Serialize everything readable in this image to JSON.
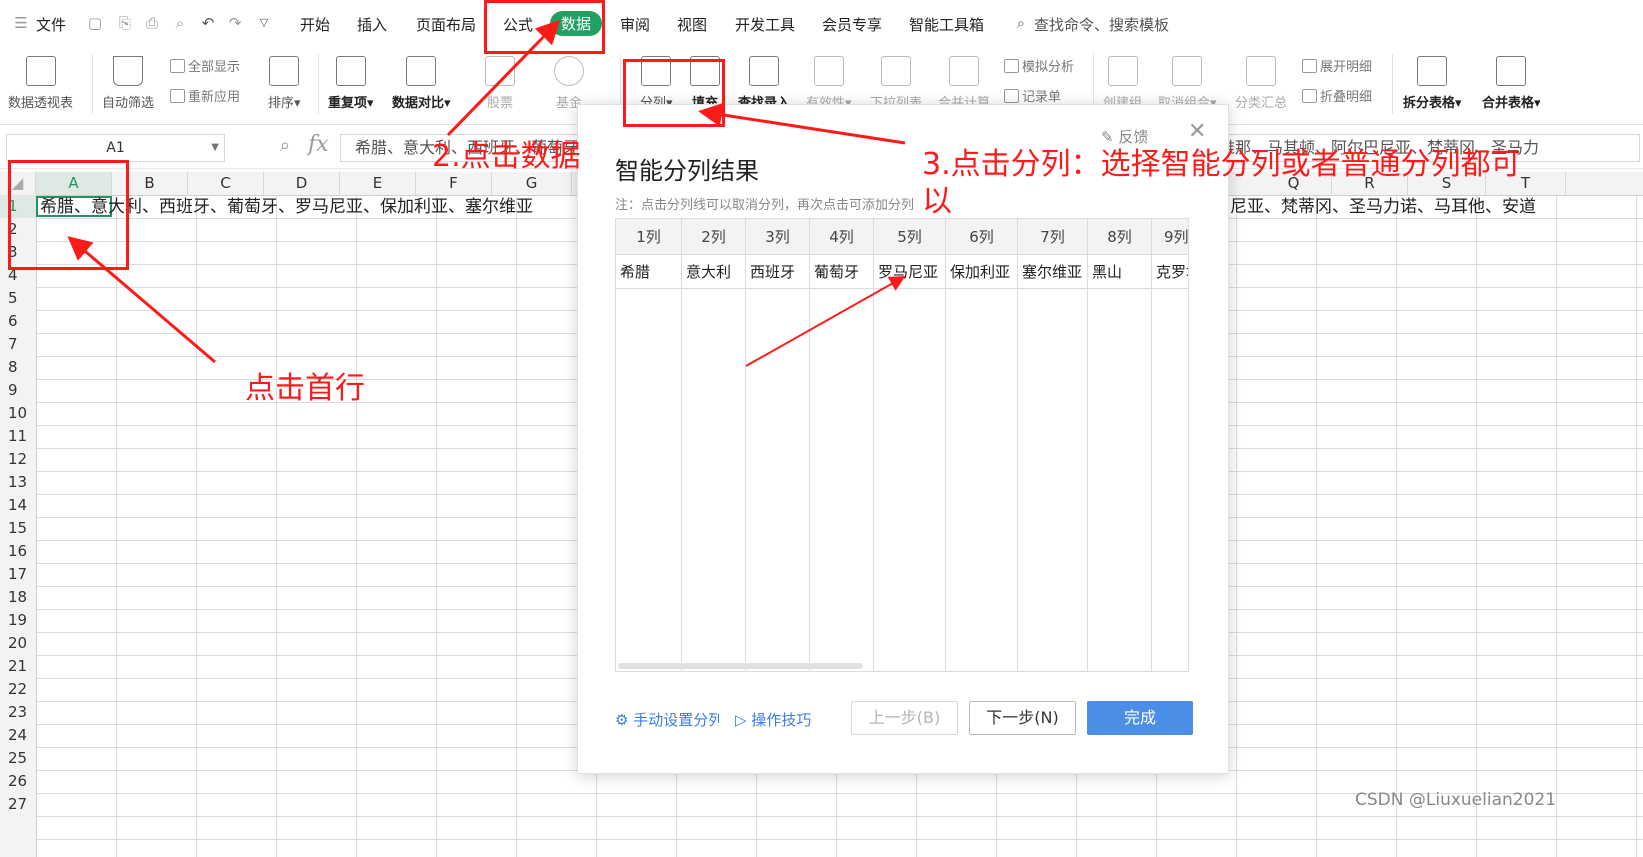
{
  "titlebar": {
    "file_menu": "文件",
    "tabs": [
      "开始",
      "插入",
      "页面布局",
      "公式",
      "数据",
      "审阅",
      "视图",
      "开发工具",
      "会员专享",
      "智能工具箱"
    ],
    "search": "查找命令、搜索模板"
  },
  "ribbon": {
    "items": [
      "数据透视表",
      "自动筛选",
      "全部显示",
      "重新应用",
      "排序",
      "重复项",
      "数据对比",
      "股票",
      "基金",
      "分列",
      "填充",
      "查找录入",
      "有效性",
      "下拉列表",
      "合并计算",
      "模拟分析",
      "记录单",
      "创建组",
      "取消组合",
      "分类汇总",
      "展开明细",
      "折叠明细",
      "拆分表格",
      "合并表格"
    ]
  },
  "formula_bar": {
    "name_box": "A1",
    "fx": "fx",
    "content": "希腊、意大利、西班牙、葡萄牙"
  },
  "sheet": {
    "columns": [
      "A",
      "B",
      "C",
      "D",
      "E",
      "F",
      "G",
      "Q",
      "R",
      "S",
      "T"
    ],
    "rows": [
      "1",
      "2",
      "3",
      "4",
      "5",
      "6",
      "7",
      "8",
      "9",
      "10",
      "11",
      "12",
      "13",
      "14",
      "15",
      "16",
      "17",
      "18",
      "19",
      "20",
      "21",
      "22",
      "23",
      "24",
      "25",
      "26",
      "27"
    ],
    "a1_text": "希腊、意大利、西班牙、葡萄牙、罗马尼亚、保加利亚、塞尔维亚",
    "row1_tail": "尼亚、梵蒂冈、圣马力诺、马耳他、安道",
    "formula_tail": "维那、马其顿、阿尔巴尼亚、梵蒂冈、圣马力"
  },
  "dialog": {
    "title": "智能分列结果",
    "note": "注：点击分列线可以取消分列，再次点击可添加分列",
    "feedback": "反馈",
    "close": "✕",
    "columns": [
      "1列",
      "2列",
      "3列",
      "4列",
      "5列",
      "6列",
      "7列",
      "8列",
      "9列"
    ],
    "values": [
      "希腊",
      "意大利",
      "西班牙",
      "葡萄牙",
      "罗马尼亚",
      "保加利亚",
      "塞尔维亚",
      "黑山",
      "克罗地"
    ],
    "manual_link": "手动设置分列",
    "tips_link": "操作技巧",
    "prev_button": "上一步(B)",
    "next_button": "下一步(N)",
    "done_button": "完成"
  },
  "annotations": {
    "step1": "点击首行",
    "step2": "2.点击数据",
    "step3_line1": "3.点击分列：选择智能分列或者普通分列都可",
    "step3_line2": "以"
  },
  "watermark": "CSDN @Liuxuelian2021",
  "colors": {
    "annotation": "#ff1a1a",
    "data_tab": "#20a162",
    "primary_button": "#4a8ee8",
    "selection": "#1e9560"
  }
}
